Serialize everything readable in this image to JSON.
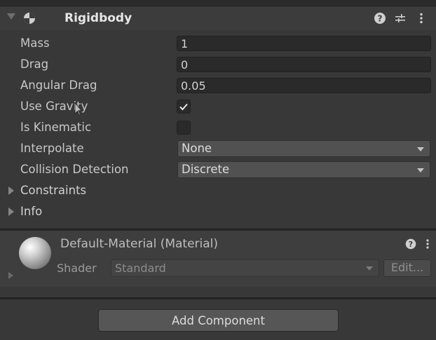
{
  "component": {
    "title": "Rigidbody",
    "icon": "rigidbody-icon",
    "header_icons": [
      "help-icon",
      "presets-icon",
      "more-options-icon"
    ]
  },
  "fields": {
    "mass": {
      "label": "Mass",
      "value": "1"
    },
    "drag": {
      "label": "Drag",
      "value": "0"
    },
    "angular_drag": {
      "label": "Angular Drag",
      "value": "0.05"
    },
    "use_gravity": {
      "label": "Use Gravity",
      "checked": true
    },
    "is_kinematic": {
      "label": "Is Kinematic",
      "checked": false
    },
    "interpolate": {
      "label": "Interpolate",
      "value": "None"
    },
    "collision_detection": {
      "label": "Collision Detection",
      "value": "Discrete"
    }
  },
  "foldouts": {
    "constraints": "Constraints",
    "info": "Info"
  },
  "material": {
    "title": "Default-Material (Material)",
    "shader_label": "Shader",
    "shader_value": "Standard",
    "edit_label": "Edit...",
    "header_icons": [
      "help-icon",
      "more-options-icon"
    ]
  },
  "add_component_label": "Add Component",
  "colors": {
    "panel_bg": "#383838",
    "field_bg": "#2a2a2a",
    "dropdown_bg": "#515151"
  }
}
